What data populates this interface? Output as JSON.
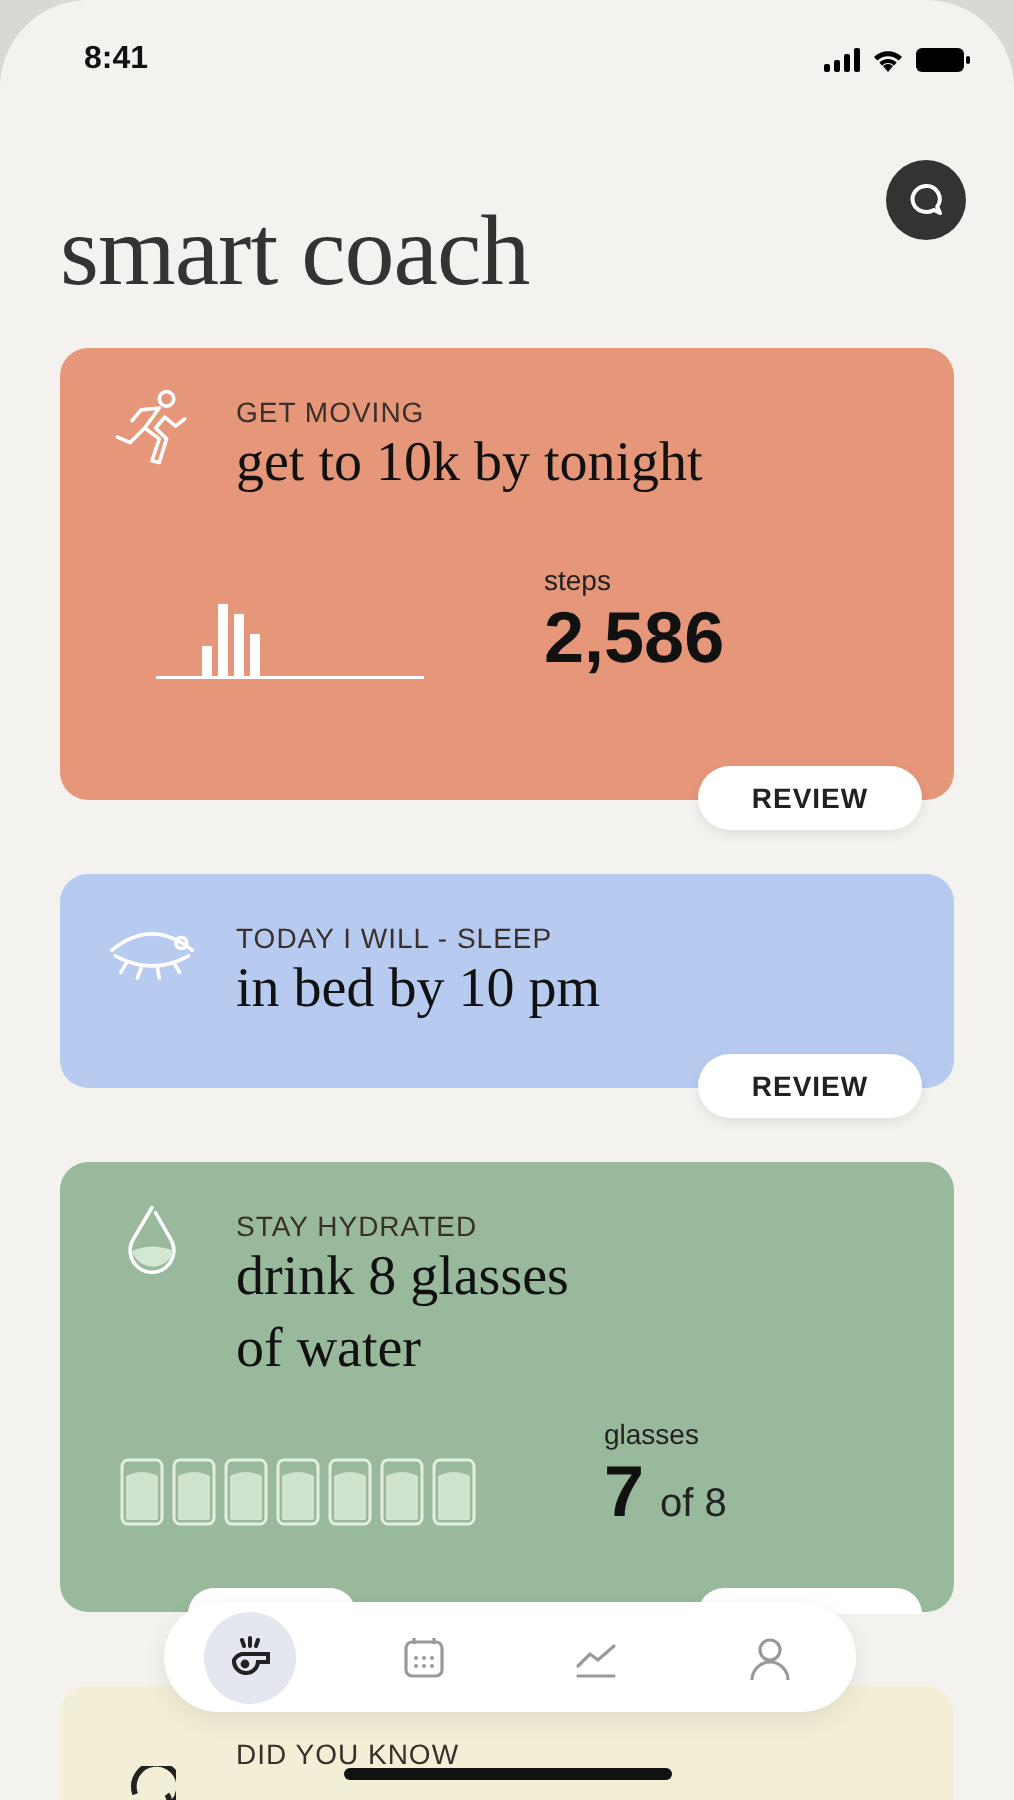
{
  "status_bar": {
    "time": "8:41"
  },
  "title": "smart coach",
  "cards": [
    {
      "kind": "steps",
      "color": "#e6977a",
      "category": "GET MOVING",
      "goal": "get to 10k by tonight",
      "metric_label": "steps",
      "metric_value": "2,586",
      "buttons": [
        {
          "label": "REVIEW"
        }
      ]
    },
    {
      "kind": "sleep",
      "color": "#b7caef",
      "category": "TODAY I WILL - SLEEP",
      "goal": "in bed by 10 pm",
      "buttons": [
        {
          "label": "REVIEW"
        }
      ]
    },
    {
      "kind": "water",
      "color": "#98b99b",
      "category": "STAY HYDRATED",
      "goal": "drink 8 glasses of water",
      "metric_label": "glasses",
      "metric_value": "7",
      "metric_suffix": "of 8",
      "glasses": [
        {
          "filled": true
        },
        {
          "filled": true
        },
        {
          "filled": true
        },
        {
          "filled": true
        },
        {
          "filled": true
        },
        {
          "filled": true
        },
        {
          "filled": true
        }
      ]
    },
    {
      "kind": "tip",
      "color": "#f3efd6",
      "category": "DID YOU KNOW"
    }
  ],
  "nav": [
    {
      "selected": true
    },
    {
      "selected": false
    },
    {
      "selected": false
    },
    {
      "selected": false
    }
  ]
}
